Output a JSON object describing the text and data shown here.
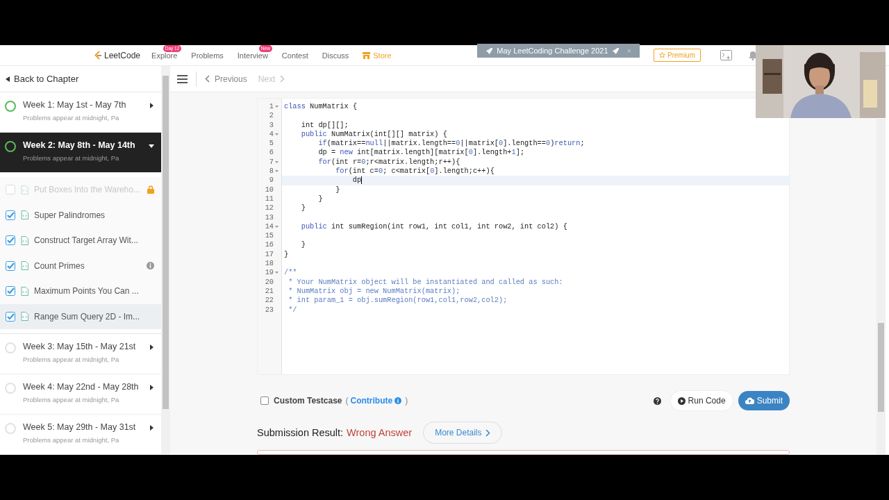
{
  "nav": {
    "logo": "LeetCode",
    "items": [
      {
        "label": "Explore",
        "badge": "Day 12",
        "accent": false
      },
      {
        "label": "Problems",
        "accent": false
      },
      {
        "label": "Interview",
        "badge": "New",
        "accent": false
      },
      {
        "label": "Contest",
        "accent": false
      },
      {
        "label": "Discuss",
        "accent": false
      },
      {
        "label": "Store",
        "accent": true
      }
    ],
    "banner": {
      "text": "May LeetCoding Challenge 2021",
      "close": "×"
    },
    "premium": "Premium"
  },
  "sidebar": {
    "back": "Back to Chapter",
    "weeks": [
      {
        "title": "Week 1: May 1st - May 7th",
        "subtitle": "Problems appear at midnight, Pa",
        "started": true,
        "expanded": false,
        "selected": false
      },
      {
        "title": "Week 2: May 8th - May 14th",
        "subtitle": "Problems appear at midnight, Pa",
        "started": true,
        "expanded": true,
        "selected": true,
        "children": [
          {
            "title": "Put Boxes Into the Wareho...",
            "checked": false,
            "locked": true,
            "info": false,
            "selected": false
          },
          {
            "title": "Super Palindromes",
            "checked": true,
            "locked": false,
            "info": false,
            "selected": false
          },
          {
            "title": "Construct Target Array Wit...",
            "checked": true,
            "locked": false,
            "info": false,
            "selected": false
          },
          {
            "title": "Count Primes",
            "checked": true,
            "locked": false,
            "info": true,
            "selected": false
          },
          {
            "title": "Maximum Points You Can ...",
            "checked": true,
            "locked": false,
            "info": false,
            "selected": false
          },
          {
            "title": "Range Sum Query 2D - Im...",
            "checked": true,
            "locked": false,
            "info": false,
            "selected": true
          }
        ]
      },
      {
        "title": "Week 3: May 15th - May 21st",
        "subtitle": "Problems appear at midnight, Pa",
        "started": false,
        "expanded": false,
        "selected": false
      },
      {
        "title": "Week 4: May 22nd - May 28th",
        "subtitle": "Problems appear at midnight, Pa",
        "started": false,
        "expanded": false,
        "selected": false
      },
      {
        "title": "Week 5: May 29th - May 31st",
        "subtitle": "Problems appear at midnight, Pa",
        "started": false,
        "expanded": false,
        "selected": false
      }
    ]
  },
  "toolbar": {
    "previous": {
      "label": "Previous",
      "disabled": false
    },
    "next": {
      "label": "Next",
      "disabled": true
    }
  },
  "editor": {
    "lines": [
      {
        "number": "1",
        "fold": true,
        "active": false,
        "tokens": [
          {
            "kind": "kw",
            "text": "class"
          },
          {
            "kind": "plain",
            "text": " NumMatrix {"
          }
        ]
      },
      {
        "number": "2",
        "fold": false,
        "active": false
      },
      {
        "number": "3",
        "fold": false,
        "active": false,
        "tokens": [
          {
            "kind": "plain",
            "text": "    int dp[][];"
          }
        ]
      },
      {
        "number": "4",
        "fold": true,
        "active": false,
        "tokens": [
          {
            "kind": "kw",
            "text": "    public"
          },
          {
            "kind": "plain",
            "text": " NumMatrix(int[][] matrix) {"
          }
        ]
      },
      {
        "number": "5",
        "fold": false,
        "active": false,
        "tokens": [
          {
            "kind": "kw",
            "text": "        if"
          },
          {
            "kind": "plain",
            "text": "(matrix=="
          },
          {
            "kind": "kw",
            "text": "null"
          },
          {
            "kind": "plain",
            "text": "||matrix.length=="
          },
          {
            "kind": "num",
            "text": "0"
          },
          {
            "kind": "plain",
            "text": "||matrix["
          },
          {
            "kind": "num",
            "text": "0"
          },
          {
            "kind": "plain",
            "text": "].length=="
          },
          {
            "kind": "num",
            "text": "0"
          },
          {
            "kind": "plain",
            "text": ")"
          },
          {
            "kind": "kw",
            "text": "return"
          },
          {
            "kind": "plain",
            "text": ";"
          }
        ]
      },
      {
        "number": "6",
        "fold": false,
        "active": false,
        "tokens": [
          {
            "kind": "plain",
            "text": "        dp = "
          },
          {
            "kind": "kw",
            "text": "new"
          },
          {
            "kind": "plain",
            "text": " int[matrix.length][matrix["
          },
          {
            "kind": "num",
            "text": "0"
          },
          {
            "kind": "plain",
            "text": "].length+"
          },
          {
            "kind": "num",
            "text": "1"
          },
          {
            "kind": "plain",
            "text": "];"
          }
        ]
      },
      {
        "number": "7",
        "fold": true,
        "active": false,
        "tokens": [
          {
            "kind": "kw",
            "text": "        for"
          },
          {
            "kind": "plain",
            "text": "(int r="
          },
          {
            "kind": "num",
            "text": "0"
          },
          {
            "kind": "plain",
            "text": ";r<matrix.length;r++){"
          }
        ]
      },
      {
        "number": "8",
        "fold": true,
        "active": false,
        "tokens": [
          {
            "kind": "kw",
            "text": "            for"
          },
          {
            "kind": "plain",
            "text": "(int c="
          },
          {
            "kind": "num",
            "text": "0"
          },
          {
            "kind": "plain",
            "text": "; c<matrix["
          },
          {
            "kind": "num",
            "text": "0"
          },
          {
            "kind": "plain",
            "text": "].length;c++){"
          }
        ]
      },
      {
        "number": "9",
        "fold": false,
        "active": true,
        "tokens": [
          {
            "kind": "plain",
            "text": "                dp"
          }
        ]
      },
      {
        "number": "10",
        "fold": false,
        "active": false,
        "tokens": [
          {
            "kind": "plain",
            "text": "            }"
          }
        ]
      },
      {
        "number": "11",
        "fold": false,
        "active": false,
        "tokens": [
          {
            "kind": "plain",
            "text": "        }"
          }
        ]
      },
      {
        "number": "12",
        "fold": false,
        "active": false,
        "tokens": [
          {
            "kind": "plain",
            "text": "    }"
          }
        ]
      },
      {
        "number": "13",
        "fold": false,
        "active": false
      },
      {
        "number": "14",
        "fold": true,
        "active": false,
        "tokens": [
          {
            "kind": "kw",
            "text": "    public"
          },
          {
            "kind": "plain",
            "text": " int sumRegion(int row1, int col1, int row2, int col2) {"
          }
        ]
      },
      {
        "number": "15",
        "fold": false,
        "active": false
      },
      {
        "number": "16",
        "fold": false,
        "active": false,
        "tokens": [
          {
            "kind": "plain",
            "text": "    }"
          }
        ]
      },
      {
        "number": "17",
        "fold": false,
        "active": false,
        "tokens": [
          {
            "kind": "plain",
            "text": "}"
          }
        ]
      },
      {
        "number": "18",
        "fold": false,
        "active": false
      },
      {
        "number": "19",
        "fold": true,
        "active": false,
        "tokens": [
          {
            "kind": "comment",
            "text": "/**"
          }
        ]
      },
      {
        "number": "20",
        "fold": false,
        "active": false,
        "tokens": [
          {
            "kind": "comment",
            "text": " * Your NumMatrix object will be instantiated and called as such:"
          }
        ]
      },
      {
        "number": "21",
        "fold": false,
        "active": false,
        "tokens": [
          {
            "kind": "comment",
            "text": " * NumMatrix obj = new NumMatrix(matrix);"
          }
        ]
      },
      {
        "number": "22",
        "fold": false,
        "active": false,
        "tokens": [
          {
            "kind": "comment",
            "text": " * int param_1 = obj.sumRegion(row1,col1,row2,col2);"
          }
        ]
      },
      {
        "number": "23",
        "fold": false,
        "active": false,
        "tokens": [
          {
            "kind": "comment",
            "text": " */"
          }
        ]
      }
    ]
  },
  "testcase": {
    "checked": false,
    "label": "Custom Testcase",
    "open": "(",
    "link": "Contribute",
    "close": ")"
  },
  "actions": {
    "run": "Run Code",
    "submit": "Submit"
  },
  "result": {
    "label": "Submission Result:",
    "status": "Wrong Answer",
    "details": "More Details"
  }
}
